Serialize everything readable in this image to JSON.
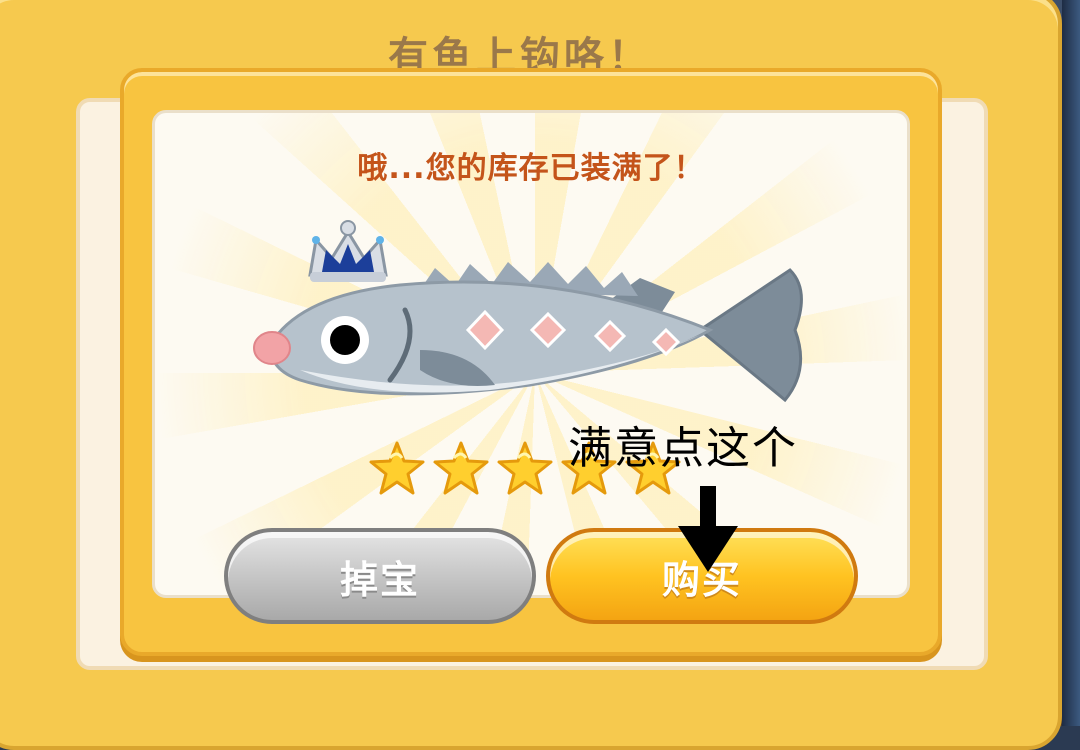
{
  "dialog": {
    "outer_title": "有鱼上钩咯！",
    "message": "哦...您的库存已装满了！"
  },
  "catch": {
    "icon": "crowned-sturgeon-icon",
    "rating": 5,
    "rating_max": 5
  },
  "buttons": {
    "drop_label": "掉宝",
    "buy_label": "购买"
  },
  "annotation": {
    "text": "满意点这个",
    "icon": "arrow-down-icon"
  },
  "colors": {
    "frame": "#f6c94e",
    "message": "#c4541a",
    "buy_button": "#ffc321",
    "drop_button": "#c9c9c9"
  }
}
